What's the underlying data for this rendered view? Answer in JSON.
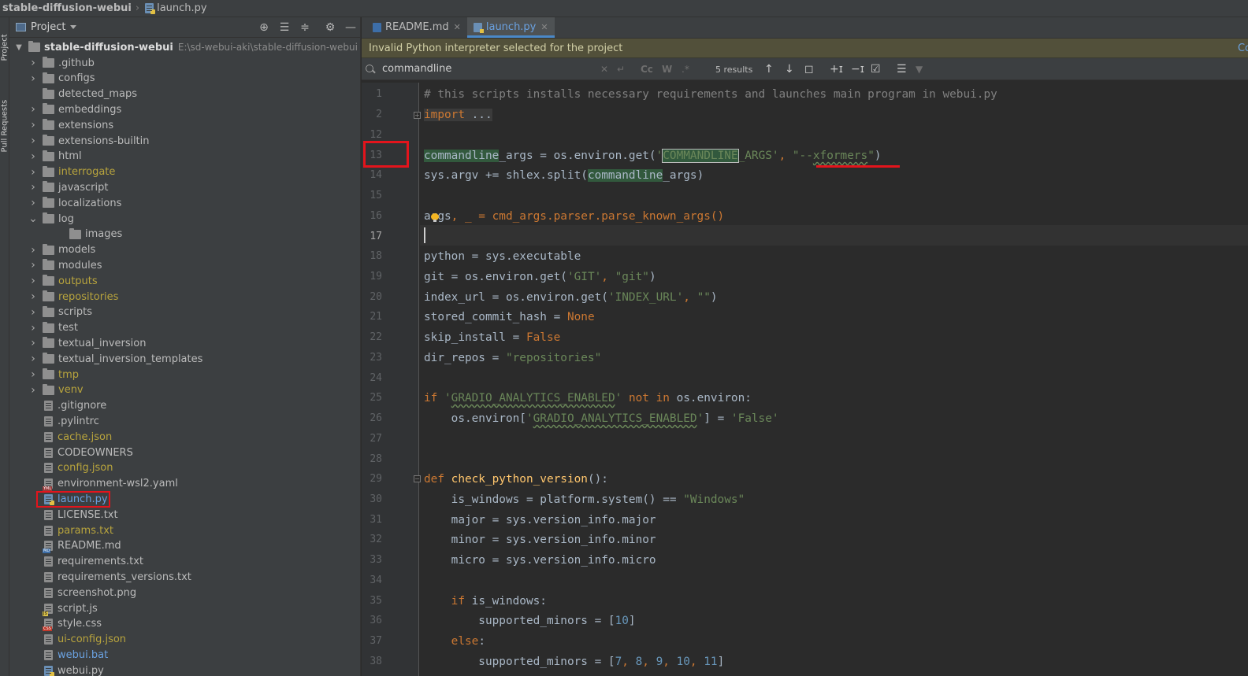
{
  "breadcrumb": {
    "project": "stable-diffusion-webui",
    "file": "launch.py"
  },
  "tool_strip": {
    "project_tab": "Project",
    "pull_requests_tab": "Pull Requests"
  },
  "project_panel": {
    "title": "Project",
    "header_icons": [
      "locate-icon",
      "expand-all-icon",
      "collapse-all-icon",
      "gear-icon",
      "minimize-icon"
    ],
    "root": {
      "name": "stable-diffusion-webui",
      "path": "E:\\sd-webui-aki\\stable-diffusion-webui"
    },
    "items": [
      {
        "name": ".github",
        "kind": "folder",
        "color": "default",
        "expandable": true,
        "depth": 1
      },
      {
        "name": "configs",
        "kind": "folder",
        "color": "default",
        "expandable": true,
        "depth": 1
      },
      {
        "name": "detected_maps",
        "kind": "folder",
        "color": "default",
        "expandable": false,
        "depth": 1
      },
      {
        "name": "embeddings",
        "kind": "folder",
        "color": "default",
        "expandable": true,
        "depth": 1
      },
      {
        "name": "extensions",
        "kind": "folder",
        "color": "default",
        "expandable": true,
        "depth": 1
      },
      {
        "name": "extensions-builtin",
        "kind": "folder",
        "color": "default",
        "expandable": true,
        "depth": 1
      },
      {
        "name": "html",
        "kind": "folder",
        "color": "default",
        "expandable": true,
        "depth": 1
      },
      {
        "name": "interrogate",
        "kind": "folder",
        "color": "yellow",
        "expandable": true,
        "depth": 1
      },
      {
        "name": "javascript",
        "kind": "folder",
        "color": "default",
        "expandable": true,
        "depth": 1
      },
      {
        "name": "localizations",
        "kind": "folder",
        "color": "default",
        "expandable": true,
        "depth": 1
      },
      {
        "name": "log",
        "kind": "folder",
        "color": "default",
        "expandable": true,
        "expanded": true,
        "depth": 1
      },
      {
        "name": "images",
        "kind": "folder",
        "color": "default",
        "expandable": false,
        "depth": 2
      },
      {
        "name": "models",
        "kind": "folder",
        "color": "default",
        "expandable": true,
        "depth": 1
      },
      {
        "name": "modules",
        "kind": "folder",
        "color": "default",
        "expandable": true,
        "depth": 1
      },
      {
        "name": "outputs",
        "kind": "folder",
        "color": "yellow",
        "expandable": true,
        "depth": 1
      },
      {
        "name": "repositories",
        "kind": "folder",
        "color": "yellow",
        "expandable": true,
        "depth": 1
      },
      {
        "name": "scripts",
        "kind": "folder",
        "color": "default",
        "expandable": true,
        "depth": 1
      },
      {
        "name": "test",
        "kind": "folder",
        "color": "default",
        "expandable": true,
        "depth": 1
      },
      {
        "name": "textual_inversion",
        "kind": "folder",
        "color": "default",
        "expandable": true,
        "depth": 1
      },
      {
        "name": "textual_inversion_templates",
        "kind": "folder",
        "color": "default",
        "expandable": true,
        "depth": 1
      },
      {
        "name": "tmp",
        "kind": "folder",
        "color": "yellow",
        "expandable": true,
        "depth": 1
      },
      {
        "name": "venv",
        "kind": "folder",
        "color": "yellow",
        "expandable": true,
        "depth": 1
      },
      {
        "name": ".gitignore",
        "kind": "file",
        "ftype": "text",
        "color": "default",
        "depth": 1
      },
      {
        "name": ".pylintrc",
        "kind": "file",
        "ftype": "text",
        "color": "default",
        "depth": 1
      },
      {
        "name": "cache.json",
        "kind": "file",
        "ftype": "json",
        "color": "yellow",
        "depth": 1
      },
      {
        "name": "CODEOWNERS",
        "kind": "file",
        "ftype": "text",
        "color": "default",
        "depth": 1
      },
      {
        "name": "config.json",
        "kind": "file",
        "ftype": "json",
        "color": "yellow",
        "depth": 1
      },
      {
        "name": "environment-wsl2.yaml",
        "kind": "file",
        "ftype": "yml",
        "color": "default",
        "depth": 1
      },
      {
        "name": "launch.py",
        "kind": "file",
        "ftype": "py",
        "color": "blue",
        "depth": 1,
        "highlighted": true
      },
      {
        "name": "LICENSE.txt",
        "kind": "file",
        "ftype": "text",
        "color": "default",
        "depth": 1
      },
      {
        "name": "params.txt",
        "kind": "file",
        "ftype": "text",
        "color": "yellow",
        "depth": 1
      },
      {
        "name": "README.md",
        "kind": "file",
        "ftype": "md",
        "color": "default",
        "depth": 1
      },
      {
        "name": "requirements.txt",
        "kind": "file",
        "ftype": "text",
        "color": "default",
        "depth": 1
      },
      {
        "name": "requirements_versions.txt",
        "kind": "file",
        "ftype": "text",
        "color": "default",
        "depth": 1
      },
      {
        "name": "screenshot.png",
        "kind": "file",
        "ftype": "text",
        "color": "default",
        "depth": 1
      },
      {
        "name": "script.js",
        "kind": "file",
        "ftype": "js",
        "color": "default",
        "depth": 1
      },
      {
        "name": "style.css",
        "kind": "file",
        "ftype": "css",
        "color": "default",
        "depth": 1
      },
      {
        "name": "ui-config.json",
        "kind": "file",
        "ftype": "json",
        "color": "yellow",
        "depth": 1
      },
      {
        "name": "webui.bat",
        "kind": "file",
        "ftype": "text",
        "color": "blue",
        "depth": 1
      },
      {
        "name": "webui.py",
        "kind": "file",
        "ftype": "py",
        "color": "default",
        "depth": 1
      }
    ]
  },
  "editor": {
    "tabs": [
      {
        "label": "README.md",
        "icon": "markdown-file-icon",
        "active": false
      },
      {
        "label": "launch.py",
        "icon": "python-file-icon",
        "active": true
      }
    ],
    "banner": {
      "text": "Invalid Python interpreter selected for the project",
      "link": "Co"
    },
    "search": {
      "query": "commandline",
      "results": "5 results",
      "option_labels": {
        "match_case": "Cc",
        "words": "W",
        "regex": ".*"
      }
    },
    "line_numbers": [
      "1",
      "2",
      "12",
      "13",
      "14",
      "15",
      "16",
      "17",
      "18",
      "19",
      "20",
      "21",
      "22",
      "23",
      "24",
      "25",
      "26",
      "27",
      "28",
      "29",
      "30",
      "31",
      "32",
      "33",
      "34",
      "35",
      "36",
      "37",
      "38"
    ],
    "current_line": "17",
    "code": {
      "l1": "# this scripts installs necessary requirements and launches main program in webui.py",
      "l2_kw": "import",
      "l2_fold": " ...",
      "l13_a": "commandline",
      "l13_b": "_args = os.environ.get(",
      "l13_c": "'",
      "l13_d": "COMMANDLINE",
      "l13_e": "_ARGS'",
      "l13_f": ", ",
      "l13_g": "\"--",
      "l13_h": "xformers",
      "l13_i": "\"",
      "l13_j": ")",
      "l14_a": "sys.argv += shlex.split(",
      "l14_b": "commandline",
      "l14_c": "_args)",
      "l16_a": "args",
      "l16_b": ", _ = cmd_args.parser.parse_known_args()",
      "l18": "python = sys.executable",
      "l19_a": "git = os.environ.get(",
      "l19_b": "'GIT'",
      "l19_c": ", ",
      "l19_d": "\"git\"",
      "l19_e": ")",
      "l20_a": "index_url = os.environ.get(",
      "l20_b": "'INDEX_URL'",
      "l20_c": ", ",
      "l20_d": "\"\"",
      "l20_e": ")",
      "l21_a": "stored_commit_hash = ",
      "l21_b": "None",
      "l22_a": "skip_install = ",
      "l22_b": "False",
      "l23_a": "dir_repos = ",
      "l23_b": "\"repositories\"",
      "l25_a": "if ",
      "l25_b": "'",
      "l25_c": "GRADIO_ANALYTICS_ENABLED",
      "l25_d": "'",
      "l25_e": " not in ",
      "l25_f": "os.environ:",
      "l26_a": "    os.environ[",
      "l26_b": "'",
      "l26_c": "GRADIO_ANALYTICS_ENABLED",
      "l26_d": "'",
      "l26_e": "] = ",
      "l26_f": "'False'",
      "l29_a": "def ",
      "l29_b": "check_python_version",
      "l29_c": "():",
      "l30_a": "    is_windows = platform.system() == ",
      "l30_b": "\"Windows\"",
      "l31": "    major = sys.version_info.major",
      "l32": "    minor = sys.version_info.minor",
      "l33": "    micro = sys.version_info.micro",
      "l35_a": "    if ",
      "l35_b": "is_windows:",
      "l36_a": "        supported_minors = [",
      "l36_b": "10",
      "l36_c": "]",
      "l37_a": "    else",
      "l37_b": ":",
      "l38_a": "        supported_minors = [",
      "l38_b": "7",
      "l38_c": ", ",
      "l38_d": "8",
      "l38_e": ", ",
      "l38_f": "9",
      "l38_g": ", ",
      "l38_h": "10",
      "l38_i": ", ",
      "l38_j": "11",
      "l38_k": "]"
    }
  }
}
